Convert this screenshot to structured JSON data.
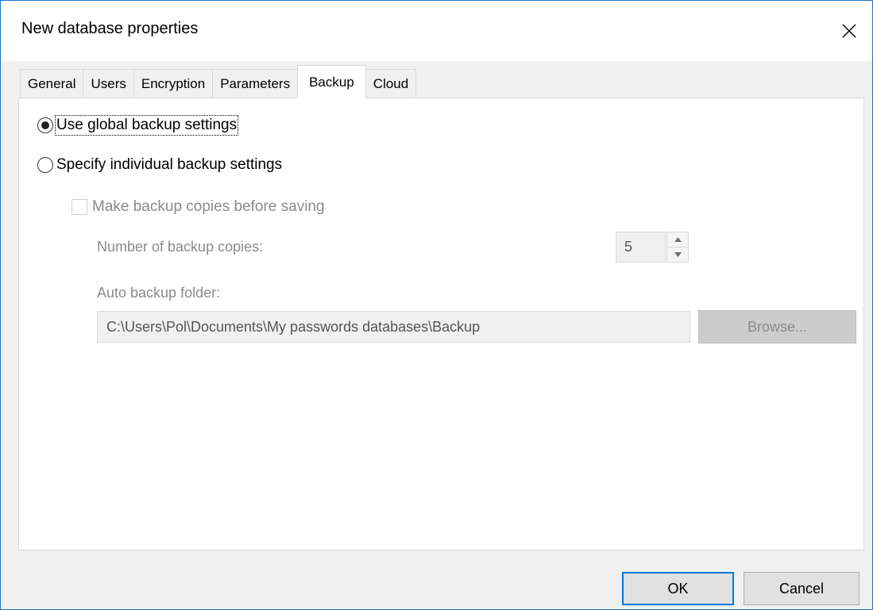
{
  "window": {
    "title": "New database properties"
  },
  "tabs": [
    {
      "label": "General"
    },
    {
      "label": "Users"
    },
    {
      "label": "Encryption"
    },
    {
      "label": "Parameters"
    },
    {
      "label": "Backup"
    },
    {
      "label": "Cloud"
    }
  ],
  "active_tab": "Backup",
  "backup": {
    "global_option_label": "Use global backup settings",
    "individual_option_label": "Specify individual backup settings",
    "selected_option": "global",
    "make_copies_label": "Make backup copies before saving",
    "make_copies_checked": false,
    "copies_label": "Number of backup copies:",
    "copies_value": "5",
    "folder_label": "Auto backup folder:",
    "folder_value": "C:\\Users\\Pol\\Documents\\My passwords databases\\Backup",
    "browse_label": "Browse..."
  },
  "footer": {
    "ok_label": "OK",
    "cancel_label": "Cancel"
  },
  "icons": {
    "close": "close-icon",
    "spin_up": "chevron-up-icon",
    "spin_down": "chevron-down-icon"
  },
  "colors": {
    "accent": "#0078d7",
    "window_border": "#1a73c8",
    "disabled_text": "#8a8a8a"
  }
}
